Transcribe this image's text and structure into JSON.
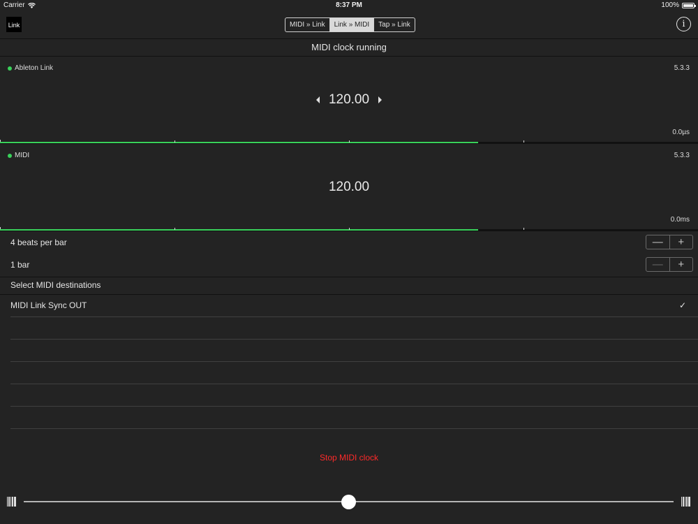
{
  "status_bar": {
    "carrier": "Carrier",
    "time": "8:37 PM",
    "battery": "100%"
  },
  "nav": {
    "logo": "Link",
    "tabs": [
      {
        "label": "MIDI » Link",
        "active": false
      },
      {
        "label": "Link » MIDI",
        "active": true
      },
      {
        "label": "Tap » Link",
        "active": false
      }
    ],
    "info": "i"
  },
  "clock_status": "MIDI clock running",
  "link_panel": {
    "label": "Ableton Link",
    "version": "5.3.3",
    "tempo": "120.00",
    "latency": "0.0µs",
    "progress": 0.685
  },
  "midi_panel": {
    "label": "MIDI",
    "version": "5.3.3",
    "tempo": "120.00",
    "latency": "0.0ms",
    "progress": 0.685
  },
  "settings": {
    "beats_per_bar": "4 beats per bar",
    "bars": "1 bar",
    "minus": "—",
    "plus": "+"
  },
  "destinations": {
    "header": "Select MIDI destinations",
    "items": [
      {
        "label": "MIDI Link Sync OUT",
        "checked": true
      }
    ],
    "check": "✓"
  },
  "stop_button": "Stop MIDI clock",
  "slider": {
    "value": 0.5
  },
  "colors": {
    "accent_green": "#39d15a",
    "stop_red": "#ff2a2a",
    "background": "#232323"
  },
  "icons": [
    "wifi-icon",
    "battery-icon",
    "info-icon",
    "arrow-left-icon",
    "arrow-right-icon",
    "checkmark-icon",
    "bars-icon"
  ]
}
